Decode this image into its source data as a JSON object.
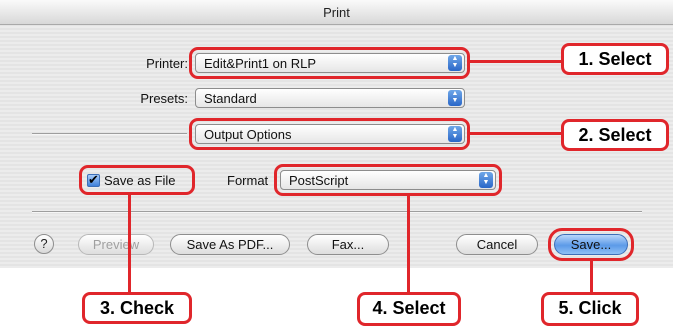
{
  "window": {
    "title": "Print"
  },
  "printer": {
    "label": "Printer:",
    "value": "Edit&Print1 on RLP"
  },
  "presets": {
    "label": "Presets:",
    "value": "Standard"
  },
  "panel": {
    "value": "Output Options"
  },
  "save_as_file": {
    "label": "Save as File",
    "checked": true,
    "check_glyph": "✔"
  },
  "format": {
    "label": "Format",
    "value": "PostScript"
  },
  "buttons": {
    "help": "?",
    "preview": "Preview",
    "save_as_pdf": "Save As PDF...",
    "fax": "Fax...",
    "cancel": "Cancel",
    "save": "Save..."
  },
  "callouts": {
    "step1": "1. Select",
    "step2": "2. Select",
    "step3": "3. Check",
    "step4": "4. Select",
    "step5": "5. Click"
  },
  "colors": {
    "annotation": "#e0262b",
    "default_button": "#5c9ae8"
  },
  "icons": {
    "popup_arrows": "updown-arrows-icon",
    "checkbox": "checkmark-icon"
  }
}
